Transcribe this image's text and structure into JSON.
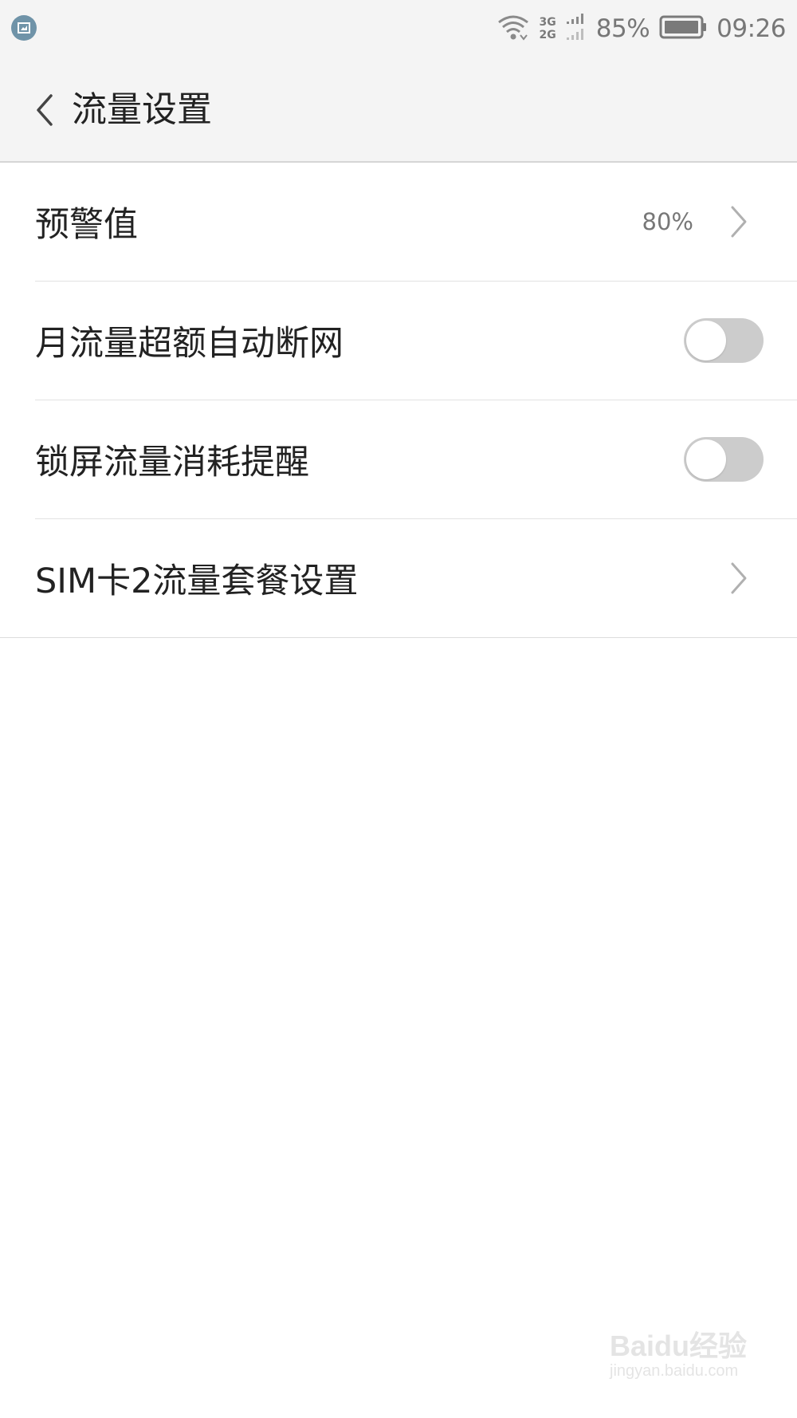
{
  "status_bar": {
    "network_top": "3G",
    "network_bottom": "2G",
    "battery_percent": "85%",
    "time": "09:26",
    "icons": [
      "notification-icon",
      "wifi-icon",
      "signal-icon",
      "battery-icon"
    ]
  },
  "header": {
    "title": "流量设置",
    "back_icon": "chevron-left-icon"
  },
  "settings": {
    "warning": {
      "label": "预警值",
      "value": "80%"
    },
    "auto_disconnect": {
      "label": "月流量超额自动断网",
      "enabled": false
    },
    "lock_screen_reminder": {
      "label": "锁屏流量消耗提醒",
      "enabled": false
    },
    "sim2_plan": {
      "label": "SIM卡2流量套餐设置"
    }
  },
  "colors": {
    "toggle_off": "#cccccc",
    "bar_bg": "#f4f4f4",
    "text": "#222222",
    "secondary": "#777777"
  },
  "watermark": {
    "brand": "Baidu经验",
    "url": "jingyan.baidu.com"
  }
}
